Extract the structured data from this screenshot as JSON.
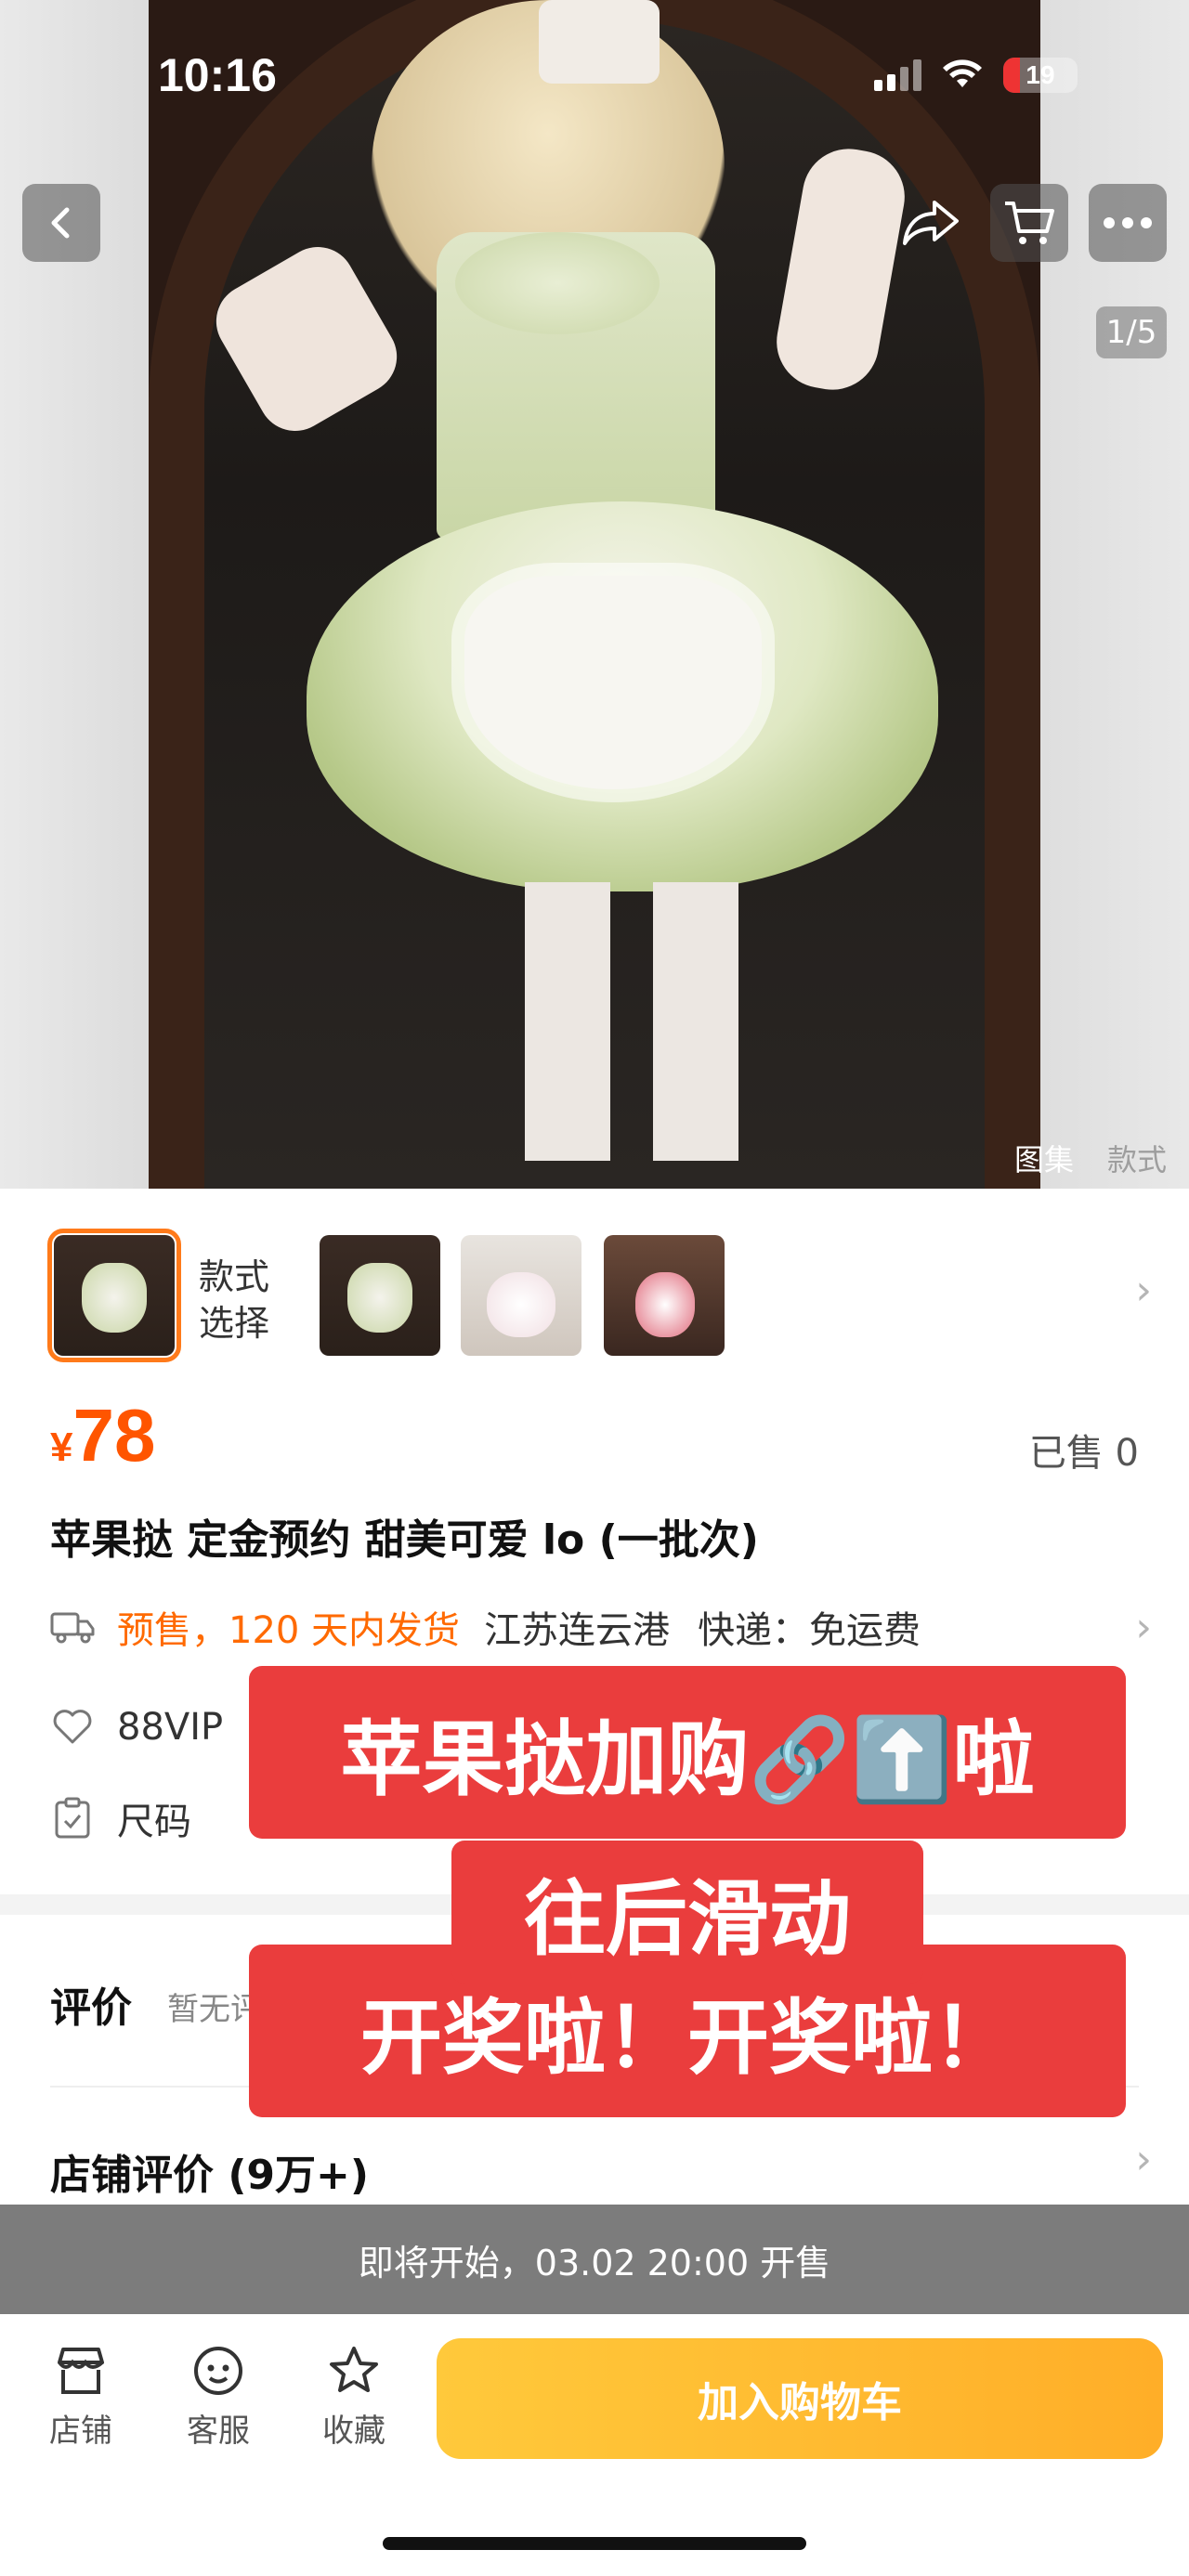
{
  "status_bar": {
    "time": "10:16",
    "battery": "19"
  },
  "nav": {
    "back": "back",
    "share": "share",
    "cart": "cart",
    "more": "more"
  },
  "gallery": {
    "page_indicator": "1/5",
    "tabs": [
      "图集",
      "款式"
    ]
  },
  "variant": {
    "label_line1": "款式",
    "label_line2": "选择"
  },
  "price": {
    "currency": "¥",
    "amount": "78",
    "sold": "已售 0"
  },
  "title": "苹果挞 定金预约 甜美可爱 lo (一批次)",
  "shipping": {
    "presale": "预售，120 天内发货",
    "origin": "江苏连云港",
    "express": "快递：免运费"
  },
  "vip": {
    "label": "88VIP"
  },
  "size": {
    "label": "尺码"
  },
  "reviews": {
    "title": "评价",
    "empty": "暂无评"
  },
  "store_reviews": {
    "title": "店铺评价 (9万+)"
  },
  "promo": {
    "line1": "苹果挞加购🔗⬆️啦",
    "line2": "往后滑动",
    "line3": "开奖啦！开奖啦！"
  },
  "sale_banner": "即将开始，03.02 20:00 开售",
  "bottom_bar": {
    "store": "店铺",
    "service": "客服",
    "favorite": "收藏",
    "add_to_cart": "加入购物车"
  },
  "colors": {
    "accent": "#ff5500",
    "presale": "#ff6a00",
    "promo_red": "#ea3d3d",
    "cart_yellow": "#ffb52e"
  }
}
